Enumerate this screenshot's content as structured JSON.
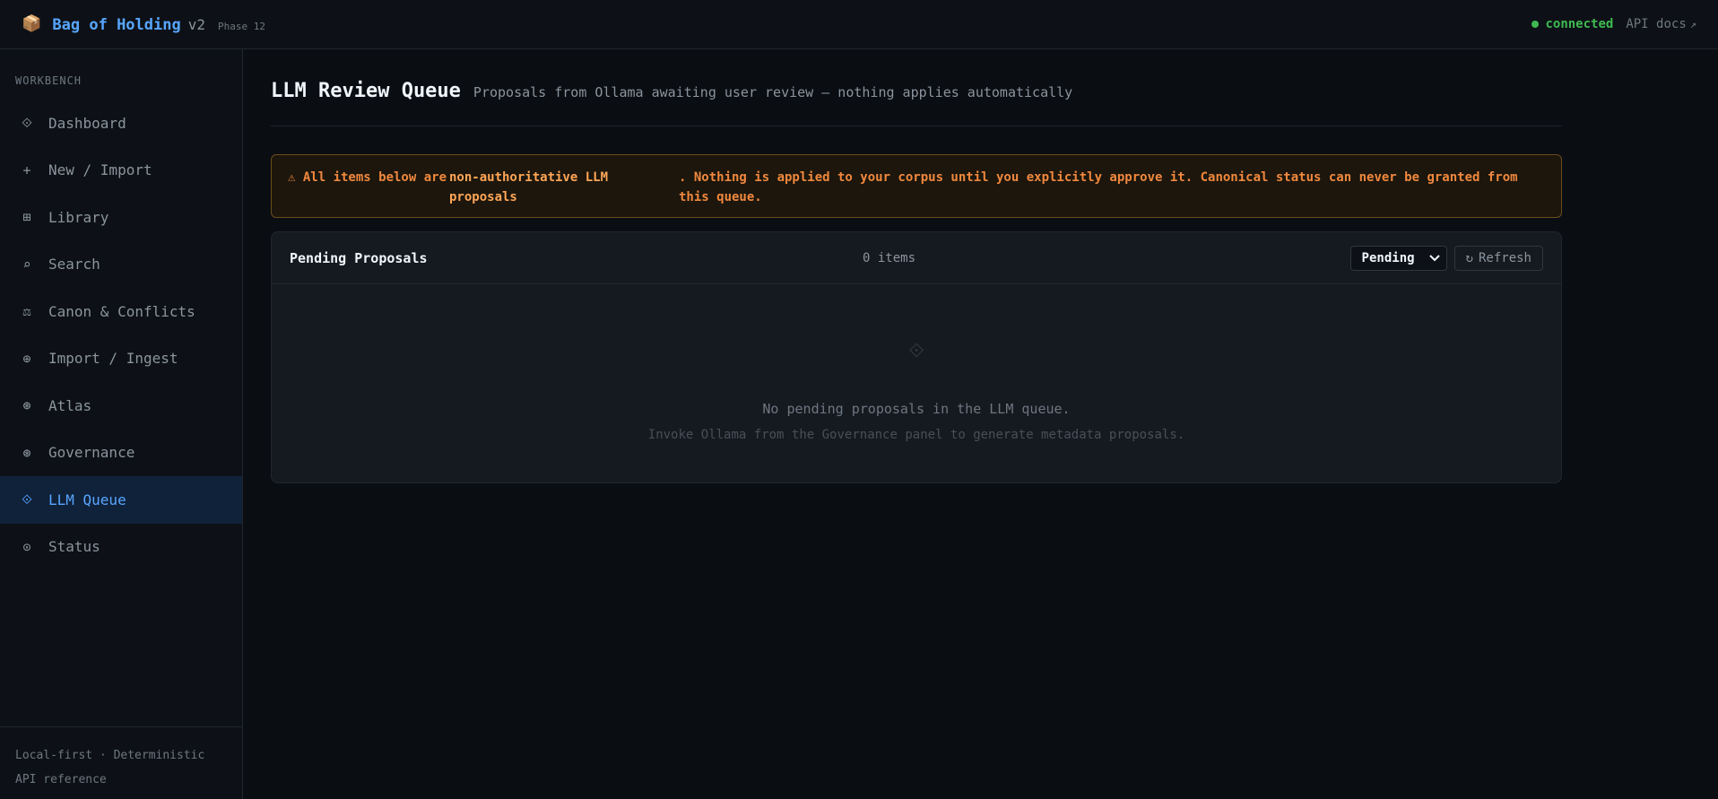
{
  "app": {
    "logo_glyph": "📦",
    "name": "Bag of Holding",
    "version": "v2",
    "phase": "Phase 12"
  },
  "topbar": {
    "status": "connected",
    "api_docs": "API docs",
    "api_docs_glyph": "↗"
  },
  "sidebar": {
    "section": "WORKBENCH",
    "items": [
      {
        "label": "Dashboard",
        "icon": "⟐"
      },
      {
        "label": "New / Import",
        "icon": "+"
      },
      {
        "label": "Library",
        "icon": "⊞"
      },
      {
        "label": "Search",
        "icon": "⌕"
      },
      {
        "label": "Canon & Conflicts",
        "icon": "⚖"
      },
      {
        "label": "Import / Ingest",
        "icon": "⊕"
      },
      {
        "label": "Atlas",
        "icon": "⊛"
      },
      {
        "label": "Governance",
        "icon": "⊛"
      },
      {
        "label": "LLM Queue",
        "icon": "⟐"
      },
      {
        "label": "Status",
        "icon": "⊙"
      }
    ],
    "active_index": 8,
    "footer_line1": "Local-first · Deterministic",
    "footer_line2": "API reference"
  },
  "page": {
    "title": "LLM Review Queue",
    "subtitle": "Proposals from Ollama awaiting user review — nothing applies automatically"
  },
  "warning": {
    "part1": "⚠ All items below are",
    "part2": "non-authoritative LLM proposals",
    "part3": ". Nothing is applied to your corpus until you explicitly approve it. Canonical status can never be granted from this queue."
  },
  "panel": {
    "title": "Pending Proposals",
    "count": "0 items",
    "filter_value": "Pending",
    "refresh_glyph": "↻",
    "refresh_label": "Refresh",
    "empty_icon": "⟐",
    "empty_message": "No pending proposals in the LLM queue.",
    "empty_hint": "Invoke Ollama from the Governance panel to generate metadata proposals."
  }
}
